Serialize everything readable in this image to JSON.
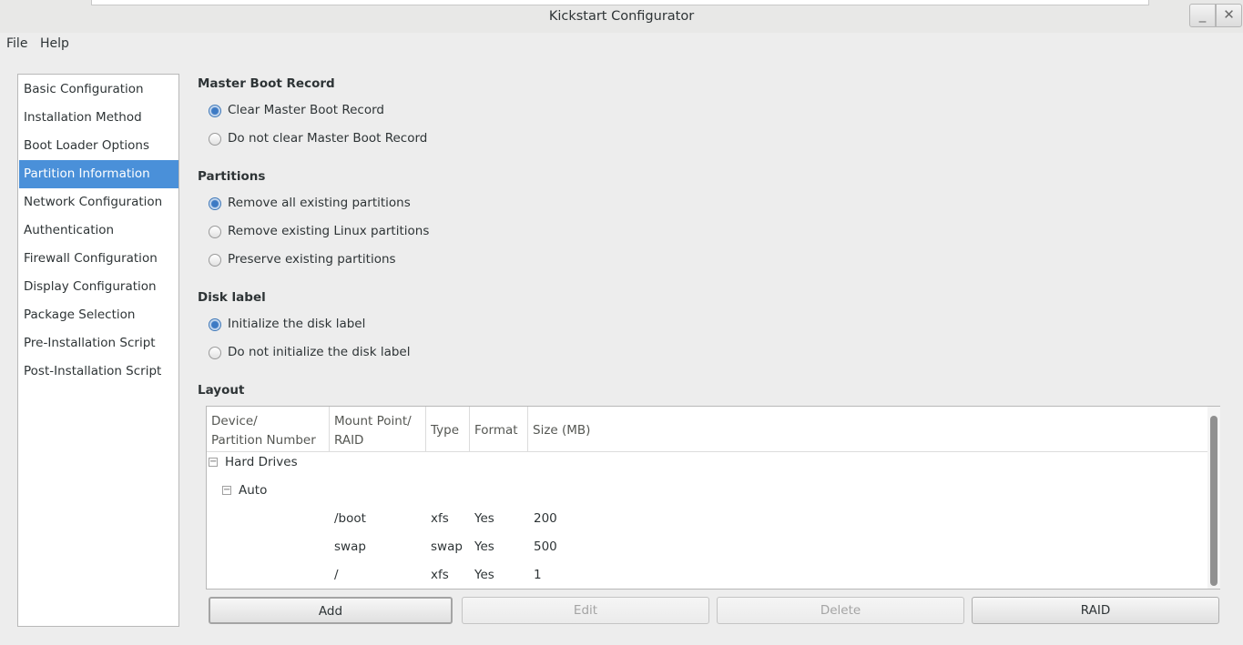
{
  "window": {
    "title": "Kickstart Configurator",
    "minimize_glyph": "_",
    "close_glyph": "✕"
  },
  "menu": {
    "items": [
      "File",
      "Help"
    ]
  },
  "sidebar": {
    "items": [
      {
        "label": "Basic Configuration"
      },
      {
        "label": "Installation Method"
      },
      {
        "label": "Boot Loader Options"
      },
      {
        "label": "Partition Information",
        "selected": true
      },
      {
        "label": "Network Configuration"
      },
      {
        "label": "Authentication"
      },
      {
        "label": "Firewall Configuration"
      },
      {
        "label": "Display Configuration"
      },
      {
        "label": "Package Selection"
      },
      {
        "label": "Pre-Installation Script"
      },
      {
        "label": "Post-Installation Script"
      }
    ]
  },
  "mbr": {
    "title": "Master Boot Record",
    "options": [
      {
        "label": "Clear Master Boot Record",
        "checked": true
      },
      {
        "label": "Do not clear Master Boot Record",
        "checked": false
      }
    ]
  },
  "partitions": {
    "title": "Partitions",
    "options": [
      {
        "label": "Remove all existing partitions",
        "checked": true
      },
      {
        "label": "Remove existing Linux partitions",
        "checked": false
      },
      {
        "label": "Preserve existing partitions",
        "checked": false
      }
    ]
  },
  "disklabel": {
    "title": "Disk label",
    "options": [
      {
        "label": "Initialize the disk label",
        "checked": true
      },
      {
        "label": "Do not initialize the disk label",
        "checked": false
      }
    ]
  },
  "layout": {
    "title": "Layout",
    "columns": {
      "device": "Device/\nPartition Number",
      "mount": "Mount Point/\nRAID",
      "type": "Type",
      "format": "Format",
      "size": "Size (MB)"
    },
    "tree": {
      "root": "Hard Drives",
      "child": "Auto",
      "expander_glyph": "−"
    },
    "rows": [
      {
        "mount": "/boot",
        "type": "xfs",
        "format": "Yes",
        "size": "200"
      },
      {
        "mount": "swap",
        "type": "swap",
        "format": "Yes",
        "size": "500"
      },
      {
        "mount": "/",
        "type": "xfs",
        "format": "Yes",
        "size": "1"
      }
    ]
  },
  "buttons": {
    "add": "Add",
    "edit": "Edit",
    "delete": "Delete",
    "raid": "RAID"
  },
  "colors": {
    "selection": "#4a90d9",
    "window_bg": "#ededed",
    "radio_checked": "#3d7ac4"
  }
}
